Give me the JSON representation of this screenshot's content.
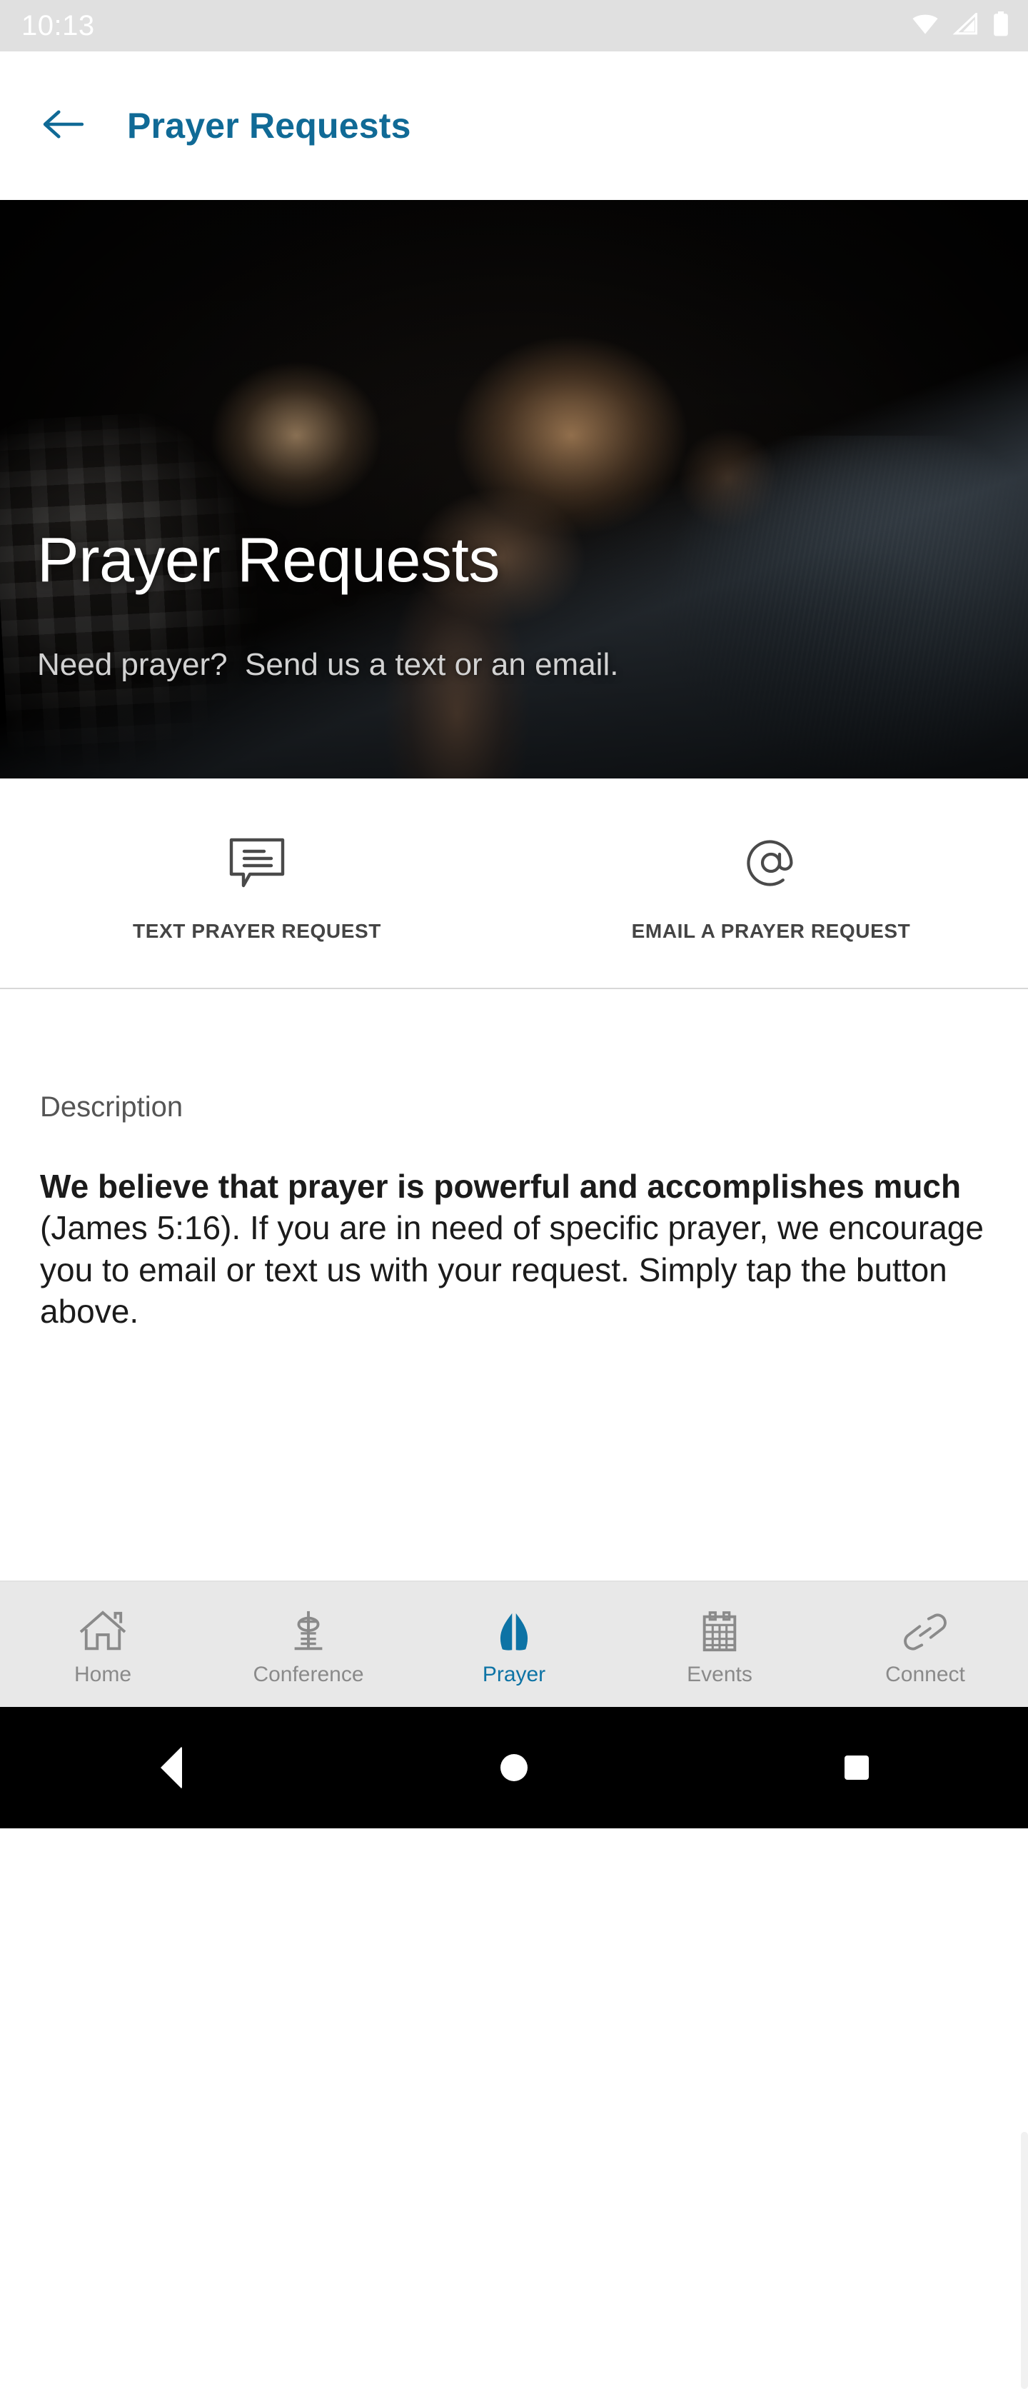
{
  "status_bar": {
    "time": "10:13",
    "icons": [
      "wifi-icon",
      "cellular-signal-icon",
      "battery-icon"
    ]
  },
  "app_bar": {
    "back_icon": "arrow-left-icon",
    "title": "Prayer Requests",
    "accent_color": "#106A96"
  },
  "hero": {
    "title": "Prayer Requests",
    "subtitle": "Need prayer?  Send us a text or an email.",
    "image_alt": "men praying with heads bowed in dim light"
  },
  "actions": [
    {
      "icon": "chat-bubble-icon",
      "label": "TEXT PRAYER REQUEST"
    },
    {
      "icon": "at-sign-icon",
      "label": "EMAIL A PRAYER REQUEST"
    }
  ],
  "description": {
    "label": "Description",
    "bold_text": "We believe that prayer is powerful and accomplishes much",
    "rest_text": " (James 5:16). If you are in need of specific prayer, we encourage you to email or text us with your request. Simply tap the button above."
  },
  "bottom_nav": {
    "active_index": 2,
    "active_color": "#0d73A5",
    "inactive_color": "#8a8a8a",
    "items": [
      {
        "icon": "home-icon",
        "label": "Home"
      },
      {
        "icon": "tower-icon",
        "label": "Conference"
      },
      {
        "icon": "praying-hands-icon",
        "label": "Prayer"
      },
      {
        "icon": "calendar-icon",
        "label": "Events"
      },
      {
        "icon": "link-icon",
        "label": "Connect"
      }
    ]
  },
  "system_nav": {
    "back": "system-back-icon",
    "home": "system-home-icon",
    "recents": "system-recents-icon"
  }
}
